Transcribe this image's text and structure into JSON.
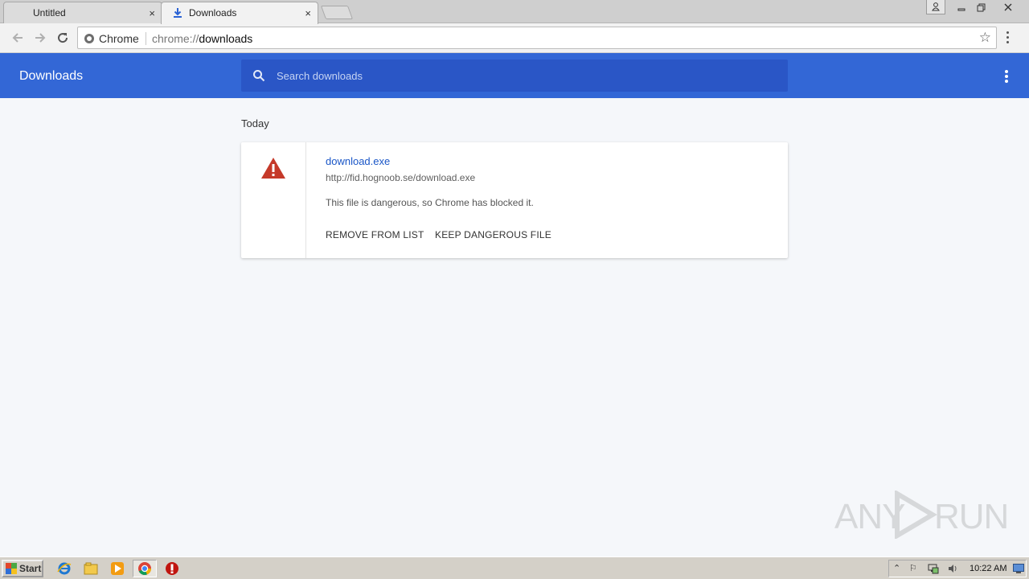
{
  "browser": {
    "tabs": [
      {
        "title": "Untitled",
        "close": "×",
        "active": false
      },
      {
        "title": "Downloads",
        "close": "×",
        "active": true,
        "icon": "download-icon"
      }
    ],
    "window_controls": [
      "user-icon",
      "minimize-icon",
      "restore-icon",
      "close-icon"
    ],
    "omnibox": {
      "scheme_label": "Chrome",
      "url_prefix": "chrome://",
      "url_path": "downloads"
    }
  },
  "downloads_page": {
    "title": "Downloads",
    "search": {
      "placeholder": "Search downloads",
      "value": ""
    },
    "section_label": "Today",
    "items": [
      {
        "file_name": "download.exe",
        "url": "http://fid.hognoob.se/download.exe",
        "message": "This file is dangerous, so Chrome has blocked it.",
        "actions": [
          "REMOVE FROM LIST",
          "KEEP DANGEROUS FILE"
        ],
        "status_icon": "warning-triangle-icon",
        "status_color": "#c53929"
      }
    ]
  },
  "colors": {
    "header": "#3367d6",
    "search_box": "#2a56c6",
    "link": "#1a56c7",
    "page_background": "#f5f7fa"
  },
  "taskbar": {
    "start_label": "Start",
    "pinned": [
      "internet-explorer-icon",
      "file-explorer-icon",
      "media-player-icon",
      "chrome-icon",
      "stop-icon"
    ],
    "clock": "10:22 AM"
  },
  "watermark": {
    "left": "ANY",
    "right": "RUN"
  }
}
